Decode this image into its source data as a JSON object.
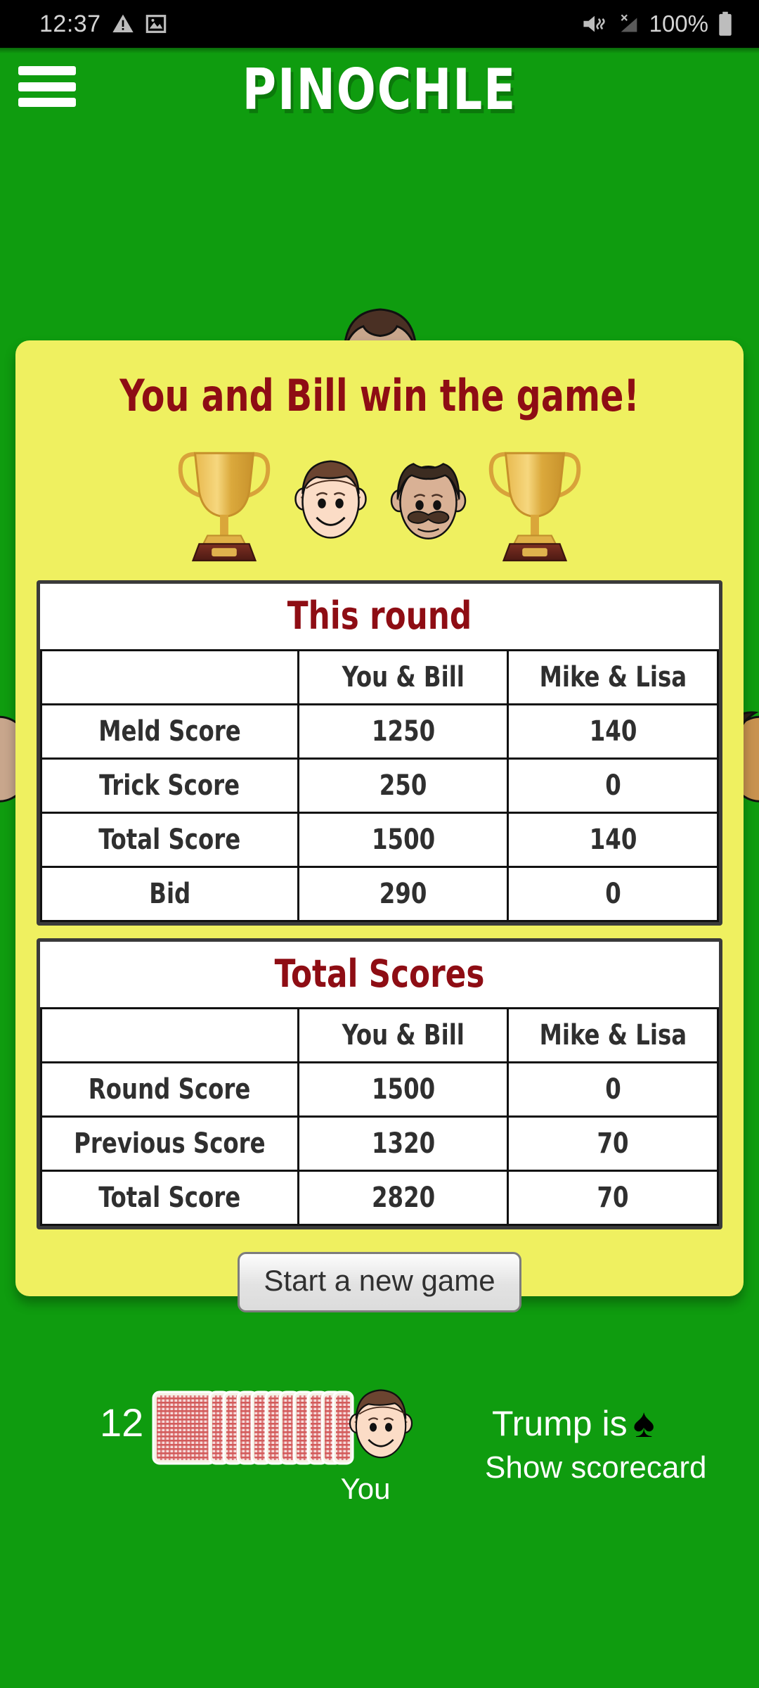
{
  "statusbar": {
    "time": "12:37",
    "battery_text": "100%",
    "icons": [
      "warning-icon",
      "image-icon",
      "vibrate-mute-icon",
      "no-signal-icon",
      "battery-icon"
    ]
  },
  "header": {
    "title": "PINOCHLE",
    "menu_icon": "hamburger-menu-icon"
  },
  "dialog": {
    "title": "You and Bill win the game!",
    "winners_icons": [
      "trophy-icon",
      "avatar-you",
      "avatar-bill",
      "trophy-icon"
    ],
    "this_round": {
      "title": "This round",
      "columns": [
        "",
        "You & Bill",
        "Mike & Lisa"
      ],
      "rows": [
        {
          "label": "Meld Score",
          "you_bill": "1250",
          "mike_lisa": "140"
        },
        {
          "label": "Trick Score",
          "you_bill": "250",
          "mike_lisa": "0"
        },
        {
          "label": "Total Score",
          "you_bill": "1500",
          "mike_lisa": "140"
        },
        {
          "label": "Bid",
          "you_bill": "290",
          "mike_lisa": "0"
        }
      ]
    },
    "total_scores": {
      "title": "Total Scores",
      "columns": [
        "",
        "You & Bill",
        "Mike & Lisa"
      ],
      "rows": [
        {
          "label": "Round Score",
          "you_bill": "1500",
          "mike_lisa": "0"
        },
        {
          "label": "Previous Score",
          "you_bill": "1320",
          "mike_lisa": "70"
        },
        {
          "label": "Total Score",
          "you_bill": "2820",
          "mike_lisa": "70"
        }
      ]
    },
    "new_game_label": "Start a new game"
  },
  "bottom": {
    "hand_count": "12",
    "you_label": "You",
    "trump_label": "Trump is",
    "trump_suit": "♠",
    "show_scorecard_label": "Show scorecard"
  },
  "colors": {
    "table_green": "#0f9c0f",
    "dialog_yellow": "#eff060",
    "heading_red": "#8e0d14",
    "card_red": "#d94f4f"
  }
}
